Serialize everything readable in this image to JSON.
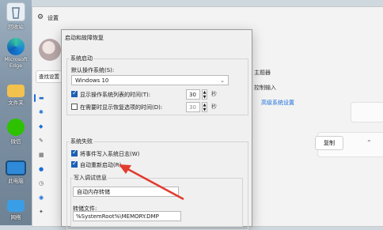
{
  "desktop": {
    "icons": [
      {
        "label": "回收站",
        "name": "recycle-bin-icon"
      },
      {
        "label": "Microsoft Edge",
        "name": "edge-icon"
      },
      {
        "label": "文件夹",
        "name": "folder-icon"
      },
      {
        "label": "微信",
        "name": "wechat-icon"
      },
      {
        "label": "此电脑",
        "name": "this-pc-icon"
      },
      {
        "label": "网络",
        "name": "network-icon"
      }
    ]
  },
  "settings": {
    "title": "设置",
    "search_placeholder": "查找设置",
    "right_texts": [
      "主题器",
      "控制输入",
      "高级系统设置"
    ],
    "copy_label": "复制"
  },
  "dialog": {
    "title": "启动和故障恢复",
    "system_startup": {
      "group_label": "系统启动",
      "default_os_label": "默认操作系统(S):",
      "default_os_value": "Windows 10",
      "show_os_list_label": "显示操作系统列表的时间(T):",
      "show_os_list_checked": true,
      "show_os_list_value": "30",
      "show_recovery_label": "在需要时显示恢复选项的时间(D):",
      "show_recovery_checked": false,
      "show_recovery_value": "30"
    },
    "system_failure": {
      "group_label": "系统失败",
      "write_event_label": "将事件写入系统日志(W)",
      "write_event_checked": true,
      "auto_restart_label": "自动重新启动(R)",
      "auto_restart_checked": true,
      "debug_group_label": "写入调试信息",
      "debug_value": "自动内存转储",
      "dump_file_label": "转储文件:",
      "dump_file_value": "%SystemRoot%\\MEMORY.DMP"
    }
  },
  "annotation_color": "#e23b2e"
}
